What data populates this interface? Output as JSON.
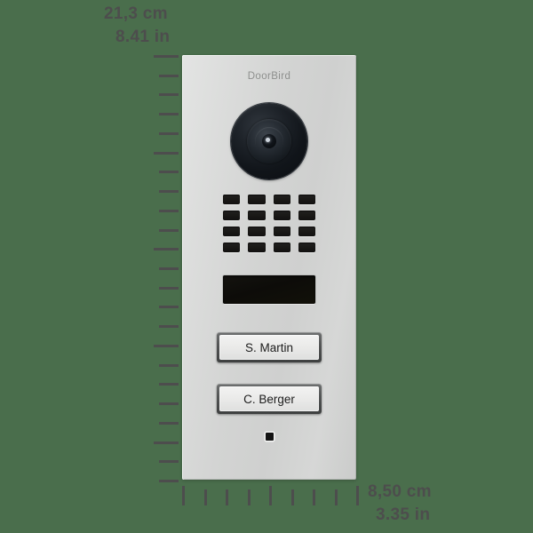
{
  "background_color": "#4a6e4c",
  "dimensions": {
    "height_cm": "21,3 cm",
    "height_in": "8.41 in",
    "width_cm": "8,50 cm",
    "width_in": "3.35 in"
  },
  "device": {
    "brand": "DoorBird",
    "panel_color": "#d6d7d6",
    "camera": {
      "icon": "camera-lens-icon"
    },
    "speaker_grille": {
      "rows": 4,
      "columns": 4,
      "slot_color": "#191816"
    },
    "ir_window": {
      "icon": "ir-sensor-window",
      "color": "#0d0c09"
    },
    "call_buttons": [
      {
        "name": "S. Martin"
      },
      {
        "name": "C. Berger"
      }
    ],
    "microphone": {
      "icon": "microphone-icon"
    }
  },
  "rulers": {
    "left": {
      "tick_count": 23,
      "major_every": 5
    },
    "bottom": {
      "tick_count": 9,
      "major_every": 4
    }
  }
}
